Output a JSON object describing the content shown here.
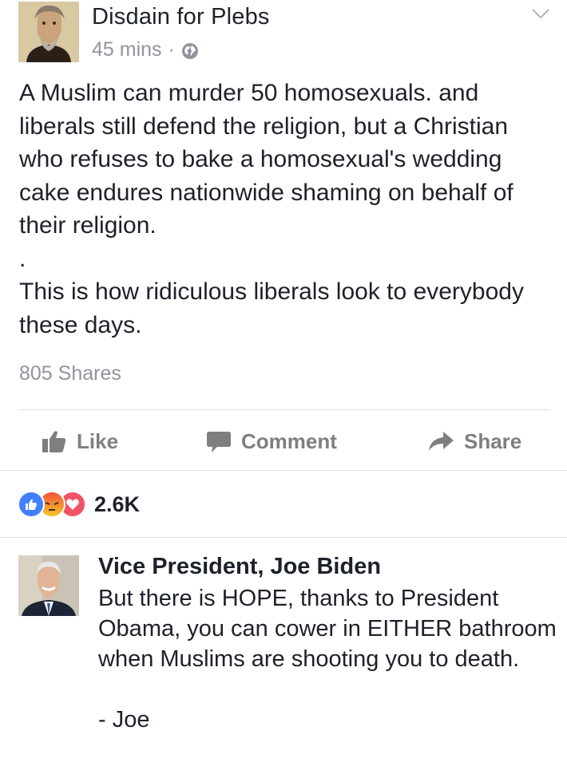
{
  "post": {
    "author": "Disdain for Plebs",
    "time": "45 mins",
    "separator": "·",
    "privacy_icon": "globe-icon",
    "menu_icon": "chevron-down-icon",
    "body": "A Muslim can murder 50 homosexuals. and liberals still defend the religion, but a Christian who refuses to bake a homosexual's wedding cake endures nationwide shaming on behalf of their religion.\n.\nThis is how ridiculous liberals look to everybody these days.",
    "shares": "805 Shares"
  },
  "actions": {
    "like_label": "Like",
    "comment_label": "Comment",
    "share_label": "Share"
  },
  "reactions": {
    "icons": [
      "like-reaction-icon",
      "angry-reaction-icon",
      "love-reaction-icon"
    ],
    "count": "2.6K"
  },
  "comment": {
    "author": "Vice President, Joe Biden",
    "text": "But there is HOPE, thanks to President Obama, you can cower in EITHER bathroom when Muslims are shooting you to death.\n\n- Joe"
  },
  "colors": {
    "text": "#1d2129",
    "meta": "#90949c",
    "action": "#7f7f7f",
    "like_blue": "#4080ff",
    "angry_yellow": "#f7b125",
    "love_red": "#f25268",
    "divider": "#dddfe2"
  }
}
